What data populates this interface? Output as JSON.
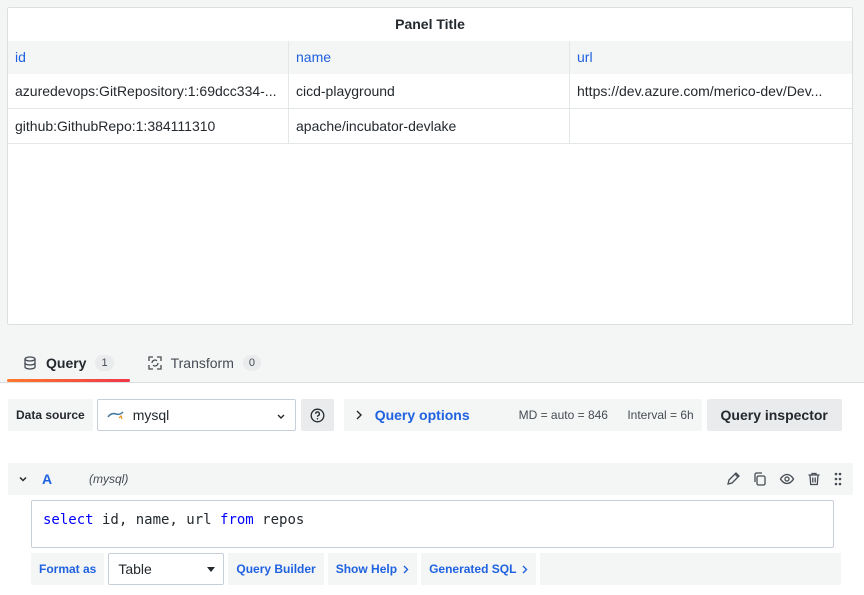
{
  "panel": {
    "title": "Panel Title",
    "columns": [
      "id",
      "name",
      "url"
    ],
    "rows": [
      [
        "azuredevops:GitRepository:1:69dcc334-...",
        "cicd-playground",
        "https://dev.azure.com/merico-dev/Dev..."
      ],
      [
        "github:GithubRepo:1:384111310",
        "apache/incubator-devlake",
        ""
      ]
    ]
  },
  "tabs": [
    {
      "label": "Query",
      "count": "1",
      "icon": "database-icon"
    },
    {
      "label": "Transform",
      "count": "0",
      "icon": "transform-icon"
    }
  ],
  "datasource": {
    "label": "Data source",
    "value": "mysql",
    "query_options_label": "Query options",
    "md": "MD = auto = 846",
    "interval": "Interval = 6h",
    "inspector_label": "Query inspector"
  },
  "query": {
    "ref_id": "A",
    "datasource_name": "(mysql)",
    "sql_keywords": [
      "select",
      "from"
    ],
    "sql_parts": [
      "select",
      " id, name, url ",
      "from",
      " repos"
    ]
  },
  "bottom": {
    "format_label": "Format as",
    "format_value": "Table",
    "query_builder": "Query Builder",
    "show_help": "Show Help",
    "generated_sql": "Generated SQL"
  },
  "colors": {
    "accent_blue": "#1f62e0",
    "tab_underline": "#f0374a",
    "sql_keyword": "#0000ff"
  }
}
